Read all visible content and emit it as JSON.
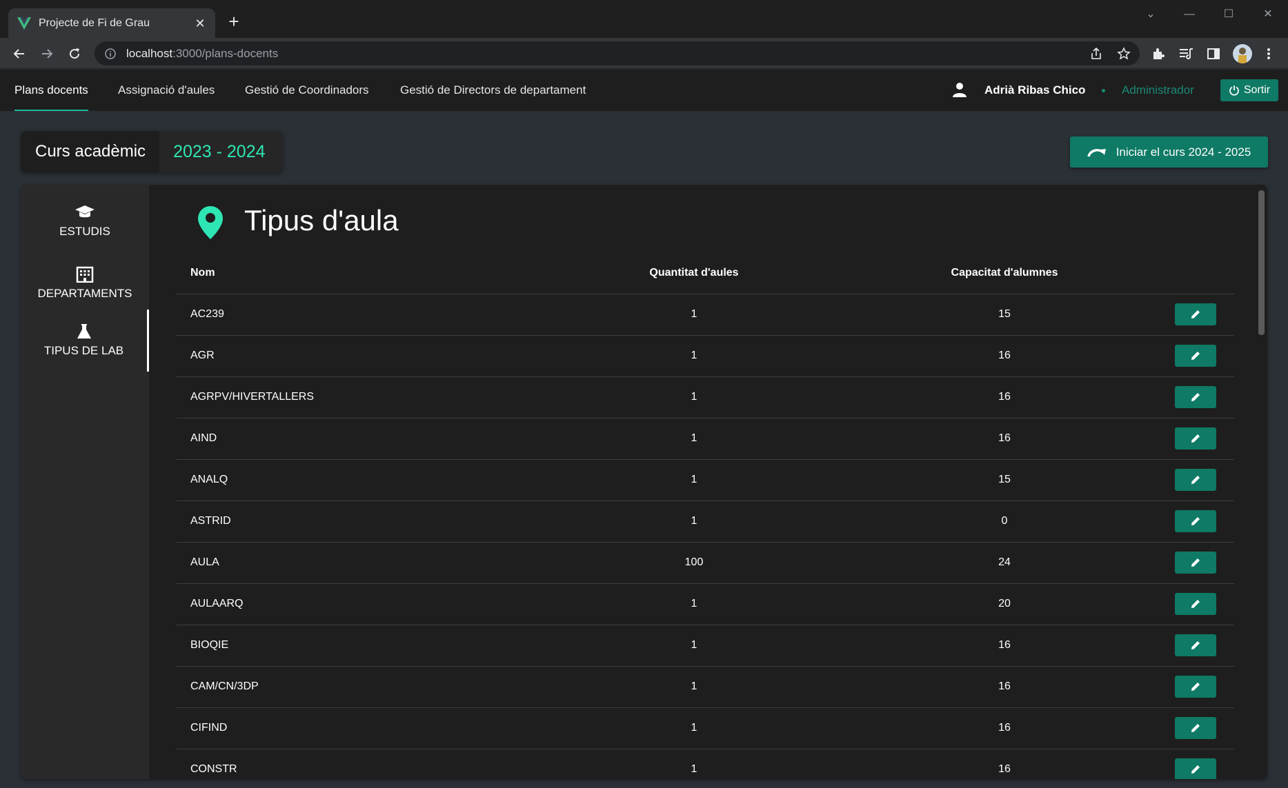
{
  "browser": {
    "tab_title": "Projecte de Fi de Grau",
    "url_host": "localhost",
    "url_rest": ":3000/plans-docents"
  },
  "nav": {
    "links": [
      "Plans docents",
      "Assignació d'aules",
      "Gestió de Coordinadors",
      "Gestió de Directors de departament"
    ],
    "user_name": "Adrià Ribas Chico",
    "user_role": "Administrador",
    "logout": "Sortir"
  },
  "course": {
    "label": "Curs acadèmic",
    "year": "2023 - 2024",
    "start_button": "Iniciar el curs 2024 - 2025"
  },
  "sidebar": {
    "items": [
      {
        "label": "ESTUDIS",
        "icon": "graduation-cap-icon"
      },
      {
        "label": "DEPARTAMENTS",
        "icon": "building-icon"
      },
      {
        "label": "TIPUS DE LAB",
        "icon": "flask-icon"
      }
    ]
  },
  "main": {
    "title": "Tipus d'aula",
    "columns": [
      "Nom",
      "Quantitat d'aules",
      "Capacitat d'alumnes"
    ],
    "rows": [
      {
        "name": "AC239",
        "quantity": "1",
        "capacity": "15"
      },
      {
        "name": "AGR",
        "quantity": "1",
        "capacity": "16"
      },
      {
        "name": "AGRPV/HIVERTALLERS",
        "quantity": "1",
        "capacity": "16"
      },
      {
        "name": "AIND",
        "quantity": "1",
        "capacity": "16"
      },
      {
        "name": "ANALQ",
        "quantity": "1",
        "capacity": "15"
      },
      {
        "name": "ASTRID",
        "quantity": "1",
        "capacity": "0"
      },
      {
        "name": "AULA",
        "quantity": "100",
        "capacity": "24"
      },
      {
        "name": "AULAARQ",
        "quantity": "1",
        "capacity": "20"
      },
      {
        "name": "BIOQIE",
        "quantity": "1",
        "capacity": "16"
      },
      {
        "name": "CAM/CN/3DP",
        "quantity": "1",
        "capacity": "16"
      },
      {
        "name": "CIFIND",
        "quantity": "1",
        "capacity": "16"
      },
      {
        "name": "CONSTR",
        "quantity": "1",
        "capacity": "16"
      }
    ]
  },
  "colors": {
    "accent": "#0f7a65",
    "accent_light": "#2ee6b3",
    "background": "#2b3036",
    "panel": "#1e1e1e"
  }
}
